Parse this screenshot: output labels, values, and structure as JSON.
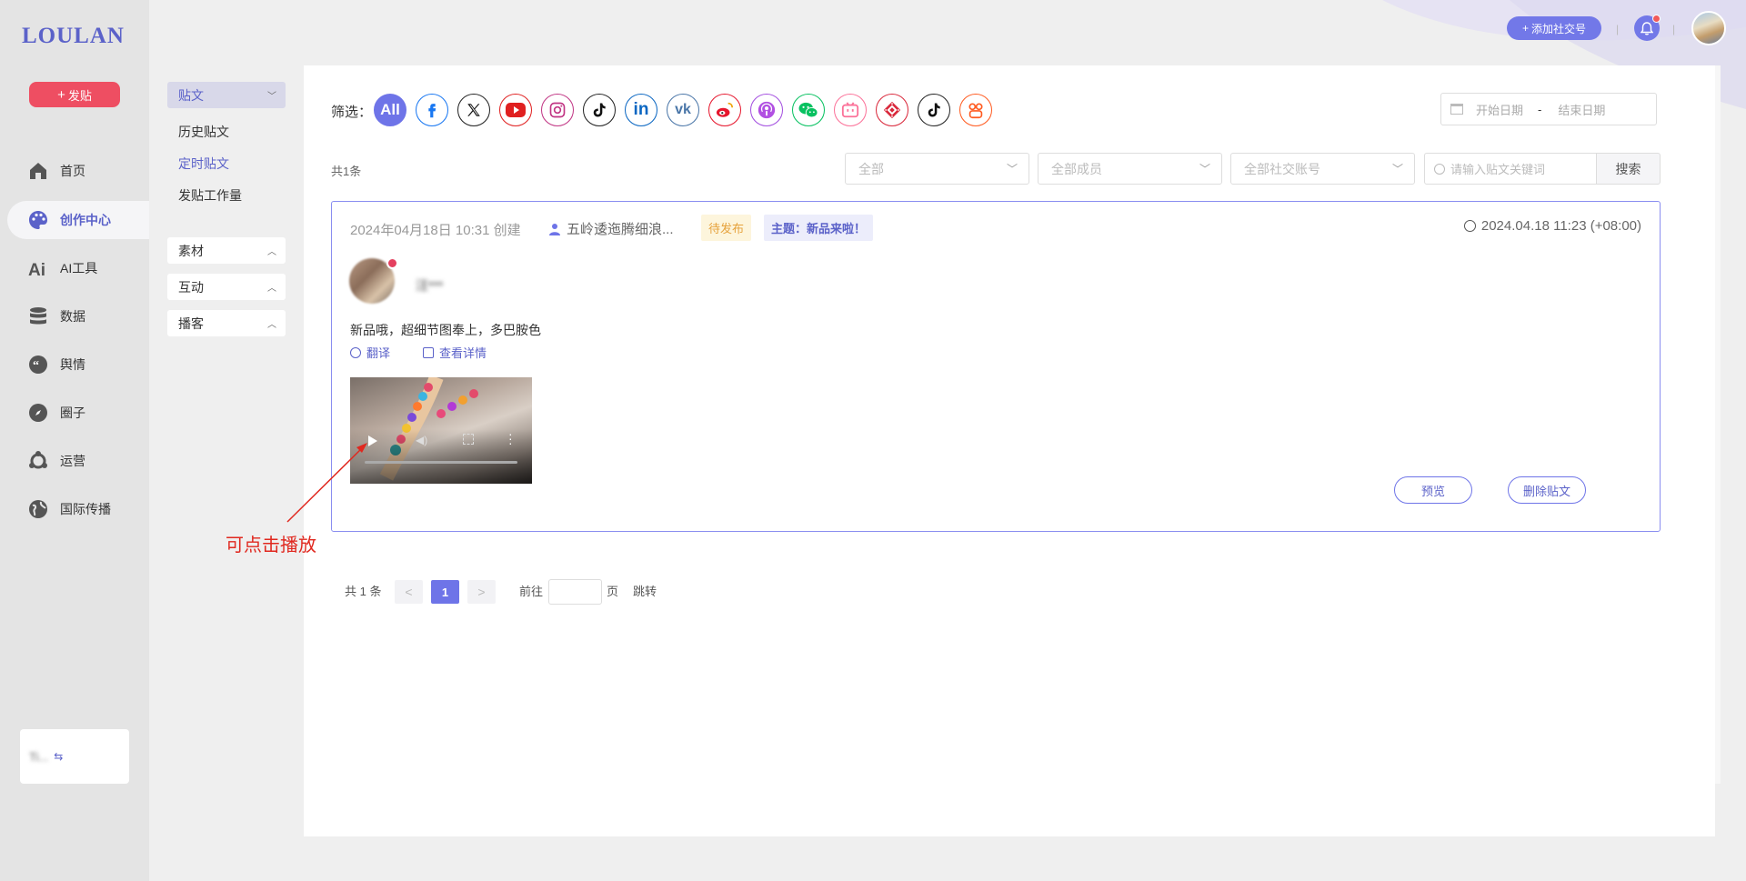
{
  "brand": {
    "logo": "LOULAN"
  },
  "nav": {
    "post_button": "发贴",
    "items": [
      {
        "label": "首页",
        "icon": "home-icon"
      },
      {
        "label": "创作中心",
        "icon": "palette-icon",
        "active": true
      },
      {
        "label": "AI工具",
        "icon": "ai-icon"
      },
      {
        "label": "数据",
        "icon": "database-icon"
      },
      {
        "label": "舆情",
        "icon": "quote-icon"
      },
      {
        "label": "圈子",
        "icon": "compass-icon"
      },
      {
        "label": "运营",
        "icon": "network-icon"
      },
      {
        "label": "国际传播",
        "icon": "globe-icon"
      }
    ],
    "account_card": {
      "name": "Ti...",
      "icon": "switch-icon"
    }
  },
  "submenu": {
    "posts_header": "贴文",
    "posts_links": [
      "历史贴文",
      "定时贴文",
      "发贴工作量"
    ],
    "active_link": "定时贴文",
    "groups": [
      "素材",
      "互动",
      "播客"
    ]
  },
  "header": {
    "add_social": "添加社交号",
    "separator": "|"
  },
  "filters": {
    "label": "筛选：",
    "all_label": "All",
    "networks": [
      "facebook-icon",
      "x-twitter-icon",
      "youtube-icon",
      "instagram-icon",
      "tiktok-icon",
      "linkedin-icon",
      "vk-icon",
      "weibo-icon",
      "podcast-icon",
      "wechat-icon",
      "bilibili-icon",
      "kuaishou-icon",
      "douyin-icon",
      "xiaohongshu-icon"
    ],
    "date_start_placeholder": "开始日期",
    "date_sep": "-",
    "date_end_placeholder": "结束日期",
    "count_text": "共1条",
    "select_all": "全部",
    "select_members": "全部成员",
    "select_accounts": "全部社交账号",
    "search_placeholder": "请输入贴文关键词",
    "search_button": "搜索"
  },
  "post": {
    "created": "2024年04月18日 10:31 创建",
    "team": "五岭逶迤腾细浪...",
    "status": "待发布",
    "topic": "主题：新品来啦！",
    "scheduled": "2024.04.18 11:23 (+08:00)",
    "author": "汪***",
    "content": "新品哦，超细节图奉上，多巴胺色",
    "translate": "翻译",
    "details": "查看详情",
    "preview_button": "预览",
    "delete_button": "删除贴文"
  },
  "annotation": {
    "text": "可点击播放"
  },
  "pagination": {
    "total": "共 1 条",
    "prev": "<",
    "current": "1",
    "next": ">",
    "goto": "前往",
    "page_unit": "页",
    "jump": "跳转"
  },
  "colors": {
    "accent": "#6e74e8",
    "post_button": "#ee4e62",
    "pending": "#e6a23c",
    "annotation": "#e0281f"
  }
}
